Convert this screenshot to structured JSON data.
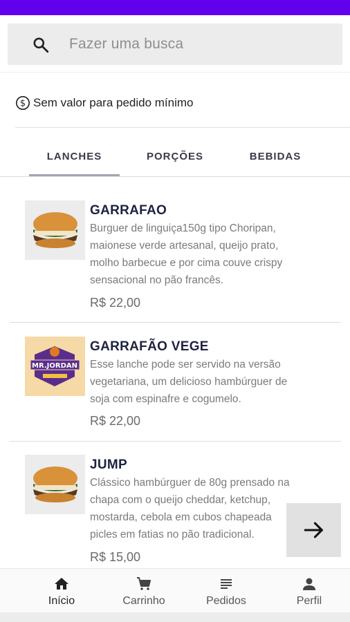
{
  "search": {
    "placeholder": "Fazer uma busca"
  },
  "info": {
    "min_order_text": "Sem valor para pedido mínimo"
  },
  "tabs": [
    {
      "label": "LANCHES",
      "active": true
    },
    {
      "label": "PORÇÕES",
      "active": false
    },
    {
      "label": "BEBIDAS",
      "active": false
    }
  ],
  "items": [
    {
      "name": "GARRAFAO",
      "desc": [
        "Burguer de linguiça150g tipo Choripan,",
        "maionese verde artesanal, queijo prato,",
        "molho barbecue e por cima couve crispy",
        "sensacional no pão francês."
      ],
      "price": "R$ 22,00",
      "image": "burger-photo"
    },
    {
      "name": "GARRAFÃO VEGE",
      "desc": [
        "Esse lanche pode ser servido na versão",
        "vegetariana, um delicioso hambúrguer de",
        "soja com espinafre e cogumelo."
      ],
      "price": "R$ 22,00",
      "image": "mr-jordan-logo",
      "logo_text": "MR.JORDAN"
    },
    {
      "name": "JUMP",
      "desc": [
        "Clássico hambúrguer de 80g prensado na",
        "chapa com o queijo cheddar, ketchup,",
        "mostarda, cebola em cubos chapeada",
        "picles em fatias no pão tradicional."
      ],
      "price": "R$ 15,00",
      "image": "burger-photo"
    }
  ],
  "nav": [
    {
      "label": "Início",
      "icon": "home-icon",
      "active": true
    },
    {
      "label": "Carrinho",
      "icon": "cart-icon",
      "active": false
    },
    {
      "label": "Pedidos",
      "icon": "list-icon",
      "active": false
    },
    {
      "label": "Perfil",
      "icon": "person-icon",
      "active": false
    }
  ],
  "colors": {
    "status_bar": "#6200ee",
    "title": "#1d2240"
  }
}
